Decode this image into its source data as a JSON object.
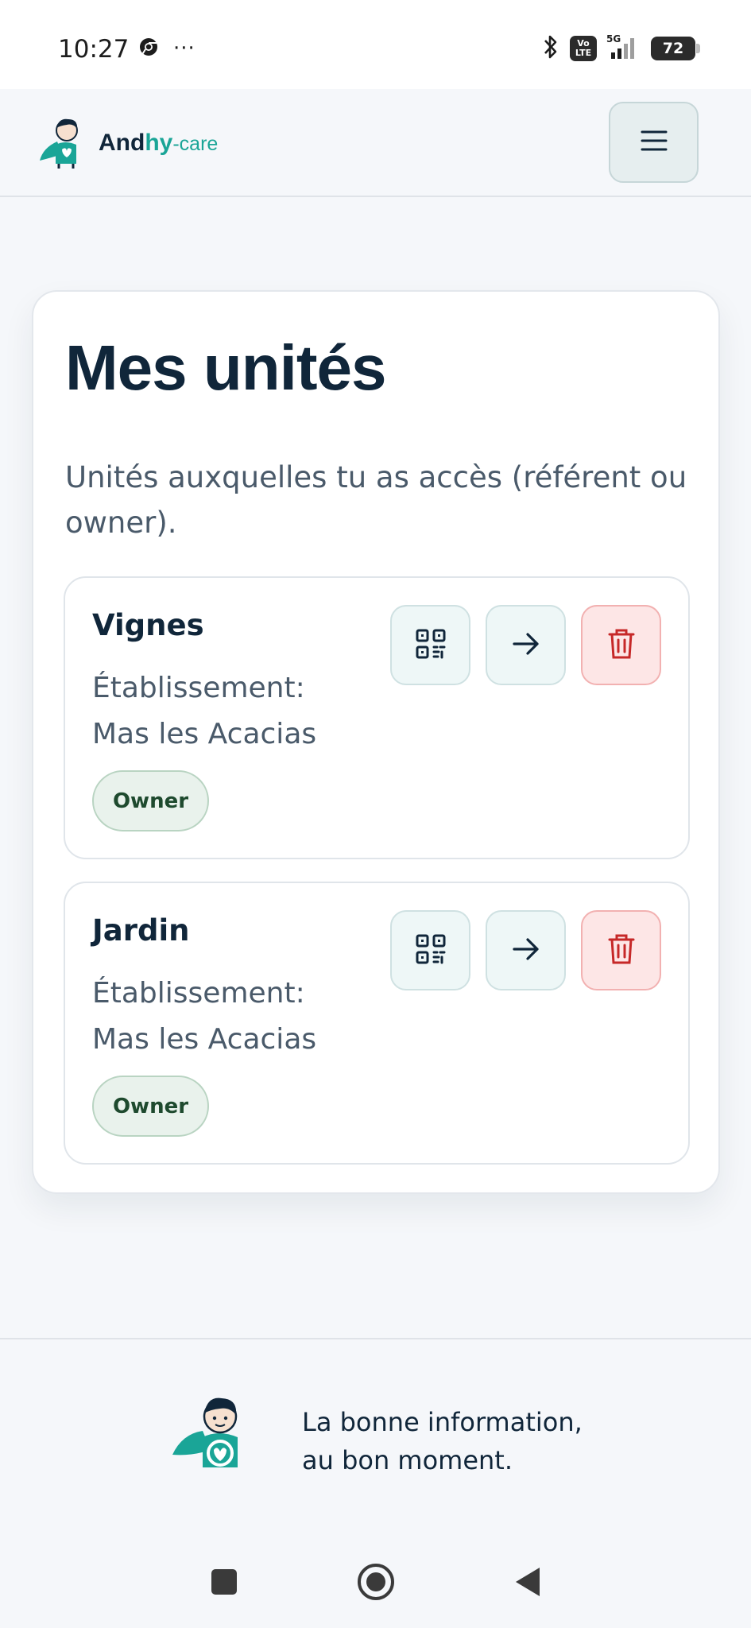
{
  "status_bar": {
    "time": "10:27",
    "more": "···",
    "network_badge": [
      "Vo",
      "LTE"
    ],
    "signal_label": "5G",
    "battery": "72"
  },
  "header": {
    "logo": {
      "part1": "And",
      "part2": "hy",
      "part3": "-care"
    },
    "menu_icon": "hamburger-icon"
  },
  "main": {
    "title": "Mes unités",
    "subtitle": "Unités auxquelles tu as accès (référent ou owner).",
    "units": [
      {
        "name": "Vignes",
        "establishment_label": "Établissement:",
        "establishment": "Mas les Acacias",
        "role": "Owner"
      },
      {
        "name": "Jardin",
        "establishment_label": "Établissement:",
        "establishment": "Mas les Acacias",
        "role": "Owner"
      }
    ]
  },
  "footer": {
    "tagline_line1": "La bonne information,",
    "tagline_line2": "au bon moment."
  },
  "colors": {
    "brand_dark": "#10263a",
    "brand_teal": "#1aa597",
    "danger": "#c62828"
  }
}
